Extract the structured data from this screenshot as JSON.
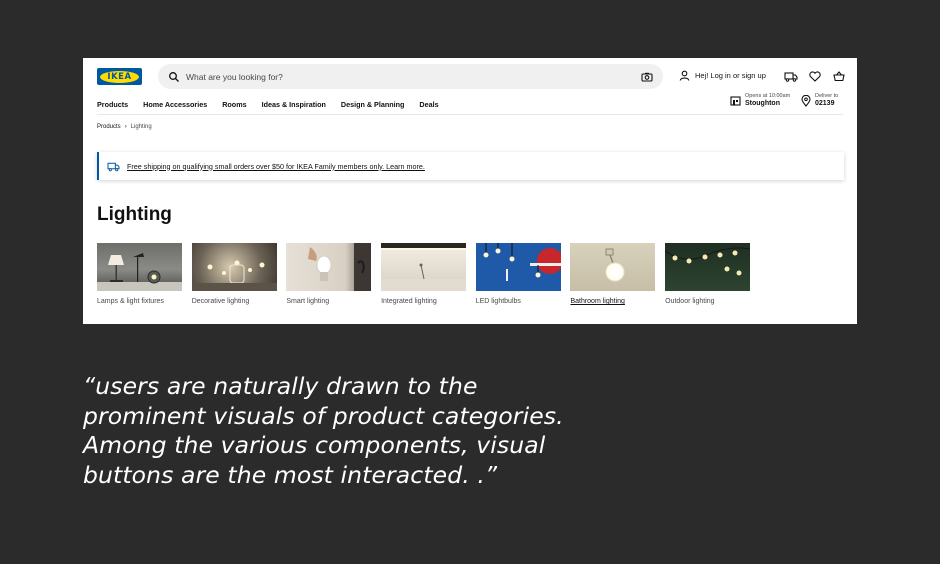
{
  "header": {
    "logo_text": "IKEA",
    "search_placeholder": "What are you looking for?",
    "login_label": "Hej! Log in or sign up"
  },
  "nav": {
    "items": [
      "Products",
      "Home Accessories",
      "Rooms",
      "Ideas & Inspiration",
      "Design & Planning",
      "Deals"
    ]
  },
  "store": {
    "hours": "Opens at 10:00am",
    "name": "Stoughton"
  },
  "delivery": {
    "label": "Deliver to",
    "zip": "02139"
  },
  "breadcrumb": {
    "root": "Products",
    "current": "Lighting"
  },
  "banner": {
    "text": "Free shipping on qualifying small orders over $50 for IKEA Family members only. Learn more."
  },
  "page": {
    "title": "Lighting"
  },
  "categories": [
    {
      "label": "Lamps & light fixtures"
    },
    {
      "label": "Decorative lighting"
    },
    {
      "label": "Smart lighting"
    },
    {
      "label": "Integrated lighting"
    },
    {
      "label": "LED lightbulbs"
    },
    {
      "label": "Bathroom lighting"
    },
    {
      "label": "Outdoor lighting"
    }
  ],
  "quote": {
    "text": "“users are naturally drawn to the prominent visuals of product categories. Among the various components, visual buttons are the most interacted. .”"
  },
  "colors": {
    "brand_blue": "#0058a3",
    "brand_yellow": "#ffdb00",
    "background": "#2b2b2b"
  }
}
